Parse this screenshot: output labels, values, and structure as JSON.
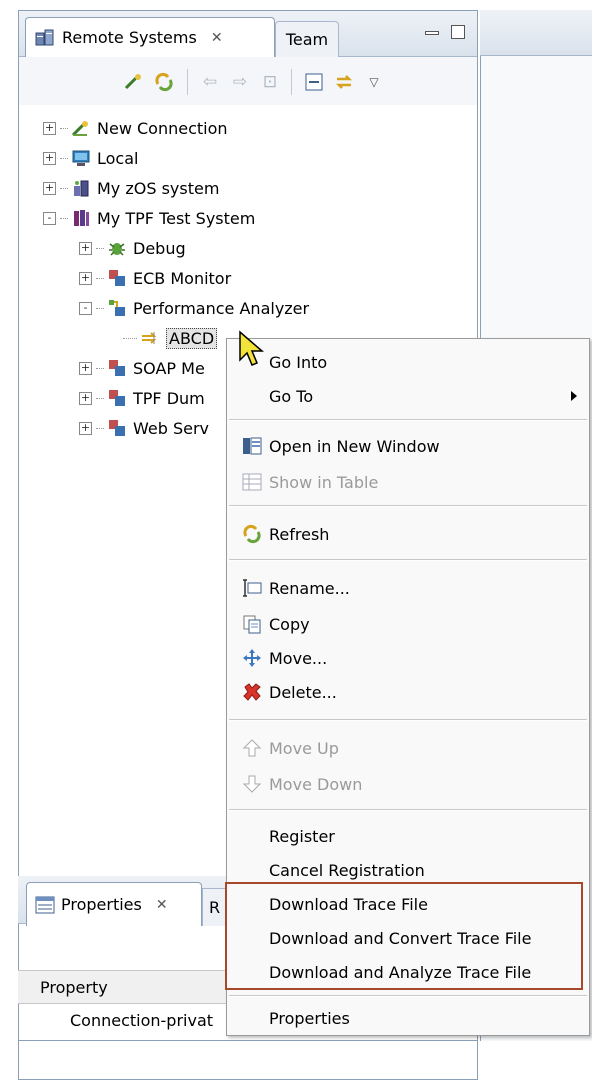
{
  "remote_systems_view": {
    "tab_title": "Remote Systems",
    "second_tab": "Team"
  },
  "tree": [
    {
      "label": "New Connection",
      "icon": "new-connection-icon",
      "expander": "+",
      "level": 0
    },
    {
      "label": "Local",
      "icon": "local-system-icon",
      "expander": "+",
      "level": 0
    },
    {
      "label": "My zOS system",
      "icon": "zos-system-icon",
      "expander": "+",
      "level": 0
    },
    {
      "label": "My TPF Test System",
      "icon": "tpf-system-icon",
      "expander": "-",
      "level": 0
    },
    {
      "label": "Debug",
      "icon": "debug-icon",
      "expander": "+",
      "level": 1
    },
    {
      "label": "ECB Monitor",
      "icon": "ecb-monitor-icon",
      "expander": "+",
      "level": 1
    },
    {
      "label": "Performance Analyzer",
      "icon": "performance-analyzer-icon",
      "expander": "-",
      "level": 1
    },
    {
      "label": "ABCD",
      "icon": "trace-item-icon",
      "expander": "",
      "level": 2,
      "selected": true
    },
    {
      "label": "SOAP Me",
      "icon": "soap-icon",
      "expander": "+",
      "level": 1
    },
    {
      "label": "TPF Dum",
      "icon": "tpf-dump-icon",
      "expander": "+",
      "level": 1
    },
    {
      "label": "Web Serv",
      "icon": "web-services-icon",
      "expander": "+",
      "level": 1
    }
  ],
  "properties_view": {
    "tab_title": "Properties",
    "second_tab_fragment": "R",
    "column_header": "Property",
    "first_row": "Connection-privat"
  },
  "context_menu": {
    "go_into": "Go Into",
    "go_to": "Go To",
    "open_in_new_window": "Open in New Window",
    "show_in_table": "Show in Table",
    "refresh": "Refresh",
    "rename": "Rename...",
    "copy": "Copy",
    "move": "Move...",
    "delete": "Delete...",
    "move_up": "Move Up",
    "move_down": "Move Down",
    "register": "Register",
    "cancel_registration": "Cancel Registration",
    "download_trace_file": "Download Trace File",
    "download_and_convert": "Download and Convert Trace File",
    "download_and_analyze": "Download and Analyze Trace File",
    "properties": "Properties"
  },
  "colors": {
    "highlight_border": "#a8482b",
    "selection_bg": "#e4e4e4"
  }
}
